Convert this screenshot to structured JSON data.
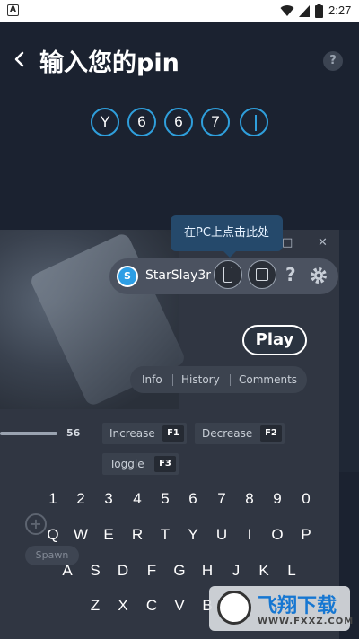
{
  "status_bar": {
    "app_badge": "A",
    "time": "2:27"
  },
  "header": {
    "title": "输入您的pin",
    "help_label": "?"
  },
  "pin": {
    "digits": [
      "Y",
      "6",
      "6",
      "7"
    ]
  },
  "tooltip": {
    "text": "在PC上点击此处"
  },
  "window_controls": {
    "maximize": "□",
    "close": "✕"
  },
  "user": {
    "avatar_letter": "S",
    "name": "StarSlay3r"
  },
  "toolbar": {
    "help_label": "?"
  },
  "play_label": "Play",
  "tabs": [
    "Info",
    "History",
    "Comments"
  ],
  "slider": {
    "value": "56"
  },
  "key_bindings": [
    {
      "label": "Increase",
      "key": "F1"
    },
    {
      "label": "Decrease",
      "key": "F2"
    },
    {
      "label": "Toggle",
      "key": "F3"
    }
  ],
  "ghost_controls": {
    "spawn_label": "Spawn",
    "plus": "+"
  },
  "keyboard": {
    "row1": [
      "1",
      "2",
      "3",
      "4",
      "5",
      "6",
      "7",
      "8",
      "9",
      "0"
    ],
    "row2": [
      "Q",
      "W",
      "E",
      "R",
      "T",
      "Y",
      "U",
      "I",
      "O",
      "P"
    ],
    "row3": [
      "A",
      "S",
      "D",
      "F",
      "G",
      "H",
      "J",
      "K",
      "L"
    ],
    "row4": [
      "Z",
      "X",
      "C",
      "V",
      "B"
    ]
  },
  "watermark": {
    "brand": "飞翔下载",
    "url": "WWW.FXXZ.COM"
  },
  "colors": {
    "accent": "#2f9fdc",
    "background": "#1b2230",
    "tooltip": "#25496b"
  }
}
